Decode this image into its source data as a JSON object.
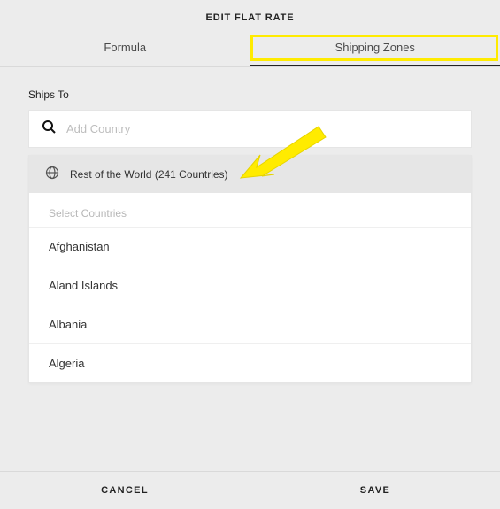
{
  "header": {
    "title": "EDIT FLAT RATE",
    "tabs": {
      "formula": "Formula",
      "shipping_zones": "Shipping Zones"
    }
  },
  "ships_label": "Ships To",
  "search": {
    "placeholder": "Add Country"
  },
  "rest_of_world": "Rest of the World (241 Countries)",
  "select_countries_label": "Select Countries",
  "countries": [
    "Afghanistan",
    "Aland Islands",
    "Albania",
    "Algeria"
  ],
  "footer": {
    "cancel": "CANCEL",
    "save": "SAVE"
  }
}
